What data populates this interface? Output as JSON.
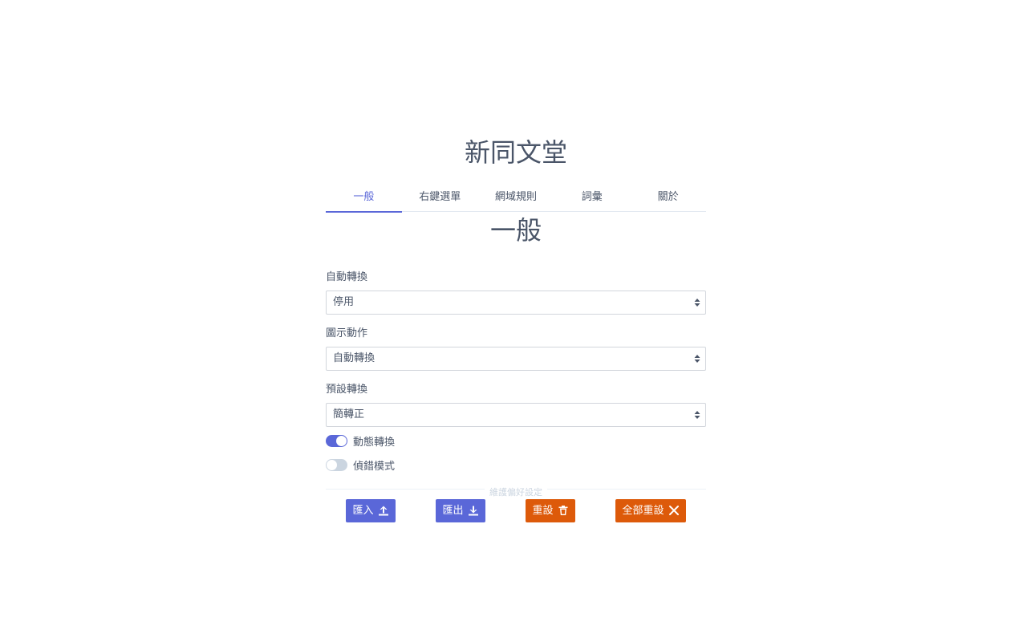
{
  "app": {
    "title": "新同文堂"
  },
  "tabs": [
    {
      "label": "一般",
      "active": true
    },
    {
      "label": "右鍵選單",
      "active": false
    },
    {
      "label": "網域規則",
      "active": false
    },
    {
      "label": "詞彙",
      "active": false
    },
    {
      "label": "關於",
      "active": false
    }
  ],
  "section": {
    "title": "一般"
  },
  "fields": {
    "auto_convert": {
      "label": "自動轉換",
      "value": "停用"
    },
    "icon_action": {
      "label": "圖示動作",
      "value": "自動轉換"
    },
    "default_convert": {
      "label": "預設轉換",
      "value": "簡轉正"
    }
  },
  "toggles": {
    "dynamic_convert": {
      "label": "動態轉換",
      "on": true
    },
    "debug_mode": {
      "label": "偵錯模式",
      "on": false
    }
  },
  "maintenance": {
    "divider_label": "維護偏好設定",
    "import_label": "匯入",
    "export_label": "匯出",
    "reset_label": "重設",
    "reset_all_label": "全部重設"
  },
  "colors": {
    "accent": "#5a67d8",
    "danger": "#dd5a0a",
    "text": "#4a5568"
  },
  "icons": {
    "import": "upload-icon",
    "export": "download-icon",
    "reset": "trash-icon",
    "reset_all": "close-icon",
    "select": "sort-arrows-icon"
  }
}
